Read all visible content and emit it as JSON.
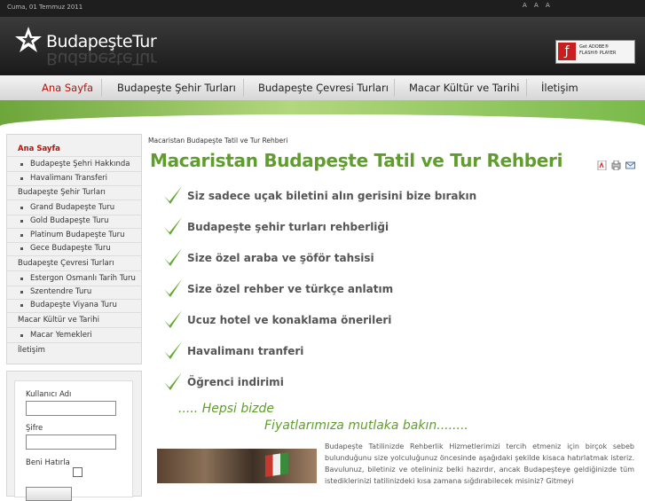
{
  "topbar": {
    "date": "Cuma, 01 Temmuz 2011",
    "font_sizer": "A A A"
  },
  "header": {
    "logo_text": "BudapeşteTur",
    "flash_badge": {
      "line1": "Get ADOBE®",
      "line2": "FLASH® PLAYER"
    }
  },
  "nav": {
    "items": [
      {
        "label": "Ana Sayfa"
      },
      {
        "label": "Budapeşte Şehir Turları"
      },
      {
        "label": "Budapeşte Çevresi Turları"
      },
      {
        "label": "Macar Kültür ve Tarihi"
      },
      {
        "label": "İletişim"
      }
    ]
  },
  "sidebar": {
    "items": [
      {
        "label": "Ana Sayfa"
      },
      {
        "label": "Budapeşte Şehri Hakkında"
      },
      {
        "label": "Havalimanı Transferi"
      },
      {
        "label": "Budapeşte Şehir Turları"
      },
      {
        "label": "Grand Budapeşte Turu"
      },
      {
        "label": "Gold Budapeşte Turu"
      },
      {
        "label": "Platinum Budapeşte Turu"
      },
      {
        "label": "Gece Budapeşte Turu"
      },
      {
        "label": "Budapeşte Çevresi Turları"
      },
      {
        "label": "Estergon Osmanlı Tarih Turu"
      },
      {
        "label": "Szentendre Turu"
      },
      {
        "label": "Budapeşte Viyana Turu"
      },
      {
        "label": "Macar Kültür ve Tarihi"
      },
      {
        "label": "Macar Yemekleri"
      },
      {
        "label": "İletişim"
      }
    ]
  },
  "login": {
    "username_label": "Kullanıcı Adı",
    "password_label": "Şifre",
    "remember_label": "Beni Hatırla"
  },
  "content": {
    "breadcrumb": "Macaristan Budapeşte Tatil ve Tur Rehberi",
    "title": "Macaristan Budapeşte Tatil ve Tur Rehberi",
    "features": [
      "Siz sadece uçak biletini alın gerisini bize bırakın",
      "Budapeşte şehir turları rehberliği",
      "Size özel araba ve şöför tahsisi",
      "Size özel rehber ve türkçe anlatım",
      "Ucuz hotel ve konaklama önerileri",
      "Havalimanı tranferi",
      "Öğrenci indirimi"
    ],
    "tagline1": "..... Hepsi bizde",
    "tagline2": "Fiyatlarımıza mutlaka bakın........",
    "body_text": "Budapeşte Tatilinizde Rehberlik Hizmetlerimizi tercih etmeniz için birçok sebeb bulunduğunu size yolculuğunuz öncesinde aşağıdaki şekilde kisaca hatırlatmak isteriz. Bavulunuz, biletiniz ve otelininiz belki hazırdır, ancak Budapeşteye geldiğinizde tüm istediklerinizi tatilinizdeki kısa zamana sığdırabilecek misiniz? Gitmeyi"
  },
  "colors": {
    "brand_green": "#5f9e2c",
    "active_red": "#b1160d"
  }
}
